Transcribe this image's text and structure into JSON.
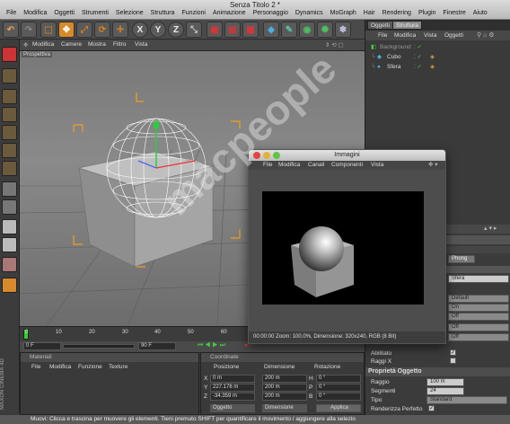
{
  "app": {
    "title": "Senza Titolo 2 *"
  },
  "menu": [
    "File",
    "Modifica",
    "Oggetti",
    "Strumenti",
    "Selezione",
    "Struttura",
    "Funzioni",
    "Animazione",
    "Personaggio",
    "Dynamics",
    "MoGraph",
    "Hair",
    "Rendering",
    "Plugin",
    "Finestre",
    "Aiuto"
  ],
  "toolbar": {
    "axis_x": "X",
    "axis_y": "Y",
    "axis_z": "Z"
  },
  "viewport": {
    "menu": [
      "Modifica",
      "Camere",
      "Mostra",
      "Filtro",
      "Vista"
    ],
    "label": "Prospettiva"
  },
  "timeline": {
    "ticks": [
      "0",
      "10",
      "20",
      "30",
      "40",
      "50",
      "60"
    ],
    "start_frame": "0 F",
    "end_frame": "90 F"
  },
  "materials": {
    "title": "Materiali",
    "menu": [
      "File",
      "Modifica",
      "Funzione",
      "Texture"
    ]
  },
  "coords": {
    "title": "Coordinate",
    "headers": [
      "Posizione",
      "Dimensione",
      "Rotazione"
    ],
    "rows": [
      {
        "axis": "X",
        "pos": "0 m",
        "dim": "200 m",
        "rot_axis": "H",
        "rot": "0 °"
      },
      {
        "axis": "Y",
        "pos": "227.176 m",
        "dim": "200 m",
        "rot_axis": "P",
        "rot": "0 °"
      },
      {
        "axis": "Z",
        "pos": "-34.359 m",
        "dim": "200 m",
        "rot_axis": "B",
        "rot": "0 °"
      }
    ],
    "mode1": "Oggetto",
    "mode2": "Dimensione",
    "apply": "Applica"
  },
  "status": {
    "text": "Muovi: Clicca e trascina per muovere gli elementi. Tieni premuto SHIFT per quantificare il movimento / aggiungere alla selezio"
  },
  "brand": "MAXON CINEMA 4D",
  "objects": {
    "tabs": [
      "Oggetti",
      "Struttura"
    ],
    "menu": [
      "File",
      "Modifica",
      "Vista",
      "Oggetti"
    ],
    "items": [
      {
        "name": "Background",
        "indent": 0
      },
      {
        "name": "Cubo",
        "indent": 1
      },
      {
        "name": "Sfera",
        "indent": 1
      }
    ]
  },
  "attributes": {
    "phong_tab": "Phong",
    "name_value": "Sfera",
    "dropdowns": [
      "Default",
      "On",
      "Off",
      "Off",
      "Off"
    ],
    "checks": [
      {
        "label": "Abilitato",
        "checked": true
      },
      {
        "label": "Raggi X",
        "checked": false
      }
    ],
    "section": "Proprietà Oggetto",
    "fields": [
      {
        "label": "Raggio",
        "value": "100 m"
      },
      {
        "label": "Segmenti",
        "value": "24"
      },
      {
        "label": "Tipo",
        "value": "Standard"
      }
    ],
    "perfect": {
      "label": "Renderizza Perfetto",
      "checked": true
    }
  },
  "image_window": {
    "title": "Immagini",
    "menu": [
      "File",
      "Modifica",
      "Canali",
      "Componenti",
      "Vista"
    ],
    "status": "00:00:00   Zoom: 100.0%, Dimensione: 320x240, RGB (8 Bit)"
  },
  "watermark": "macpeople"
}
